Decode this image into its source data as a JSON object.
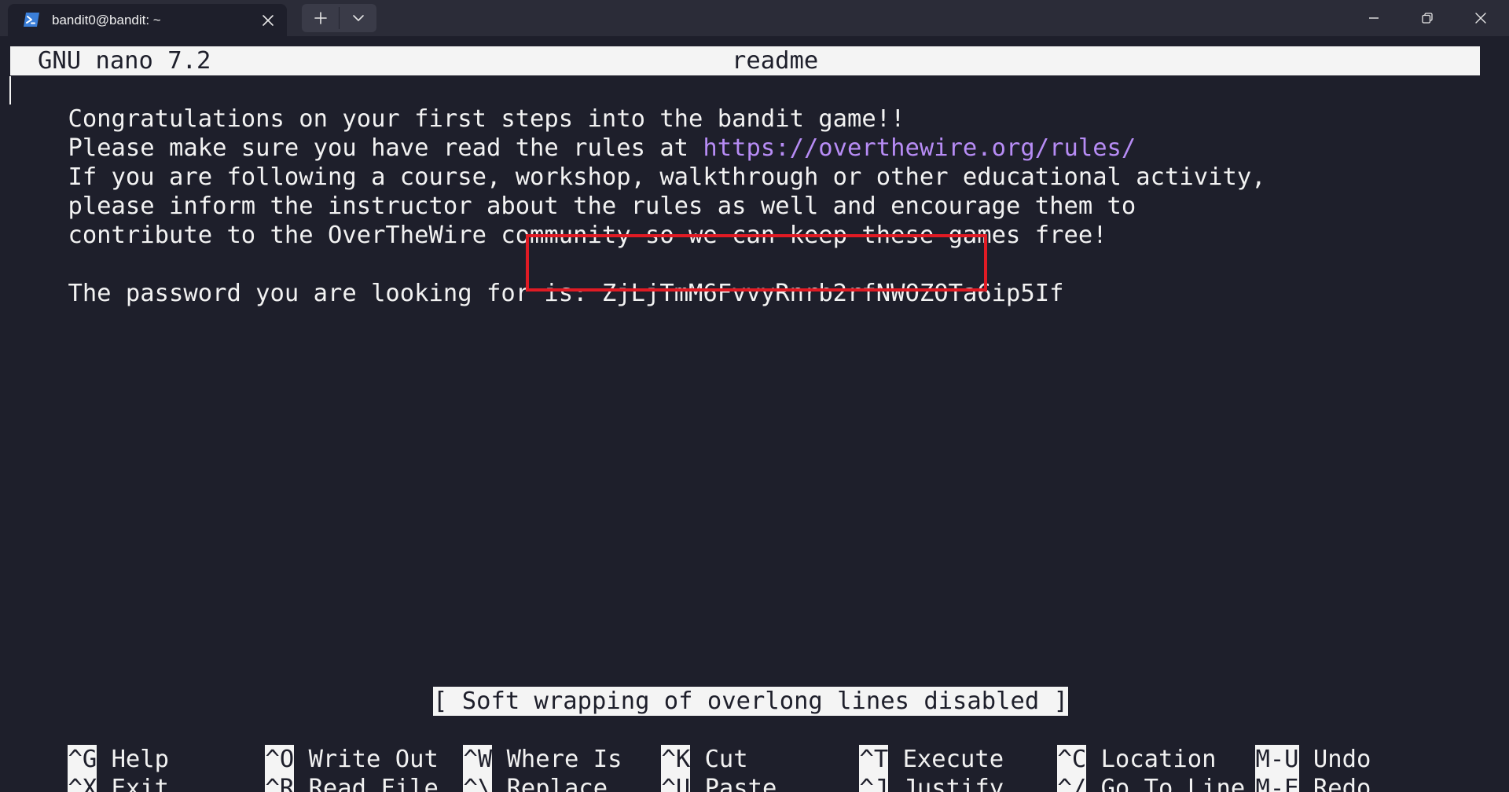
{
  "window": {
    "tab_title": "bandit0@bandit: ~",
    "tab_icon": "powershell-icon",
    "new_tab_icon": "plus-icon",
    "dropdown_icon": "chevron-down-icon",
    "controls": [
      "minimize-icon",
      "restore-icon",
      "close-icon"
    ]
  },
  "nano": {
    "version": "GNU nano 7.2",
    "filename": "readme",
    "lines": [
      {
        "text": "Congratulations on your first steps into the bandit game!!"
      },
      {
        "text": "Please make sure you have read the rules at ",
        "link": "https://overthewire.org/rules/"
      },
      {
        "text": "If you are following a course, workshop, walkthrough or other educational activity,"
      },
      {
        "text": "please inform the instructor about the rules as well and encourage them to"
      },
      {
        "text": "contribute to the OverTheWire community so we can keep these games free!"
      },
      {
        "text": ""
      },
      {
        "text": "The password you are looking for is: ",
        "password": "ZjLjTmM6FvvyRnrb2rfNWOZOTa6ip5If"
      }
    ],
    "status_message": "[ Soft wrapping of overlong lines disabled ]",
    "shortcuts": [
      {
        "key": "^G",
        "label": "Help"
      },
      {
        "key": "^X",
        "label": "Exit"
      },
      {
        "key": "^O",
        "label": "Write Out"
      },
      {
        "key": "^R",
        "label": "Read File"
      },
      {
        "key": "^W",
        "label": "Where Is"
      },
      {
        "key": "^\\",
        "label": "Replace"
      },
      {
        "key": "^K",
        "label": "Cut"
      },
      {
        "key": "^U",
        "label": "Paste"
      },
      {
        "key": "^T",
        "label": "Execute"
      },
      {
        "key": "^J",
        "label": "Justify"
      },
      {
        "key": "^C",
        "label": "Location"
      },
      {
        "key": "^/",
        "label": "Go To Line"
      },
      {
        "key": "M-U",
        "label": "Undo"
      },
      {
        "key": "M-E",
        "label": "Redo"
      }
    ]
  },
  "colors": {
    "terminal_bg": "#1e1f2b",
    "titlebar_bg": "#2b2c38",
    "foreground": "#f2f2f2",
    "link": "#b78cf5",
    "highlight_box": "#e01b24"
  }
}
